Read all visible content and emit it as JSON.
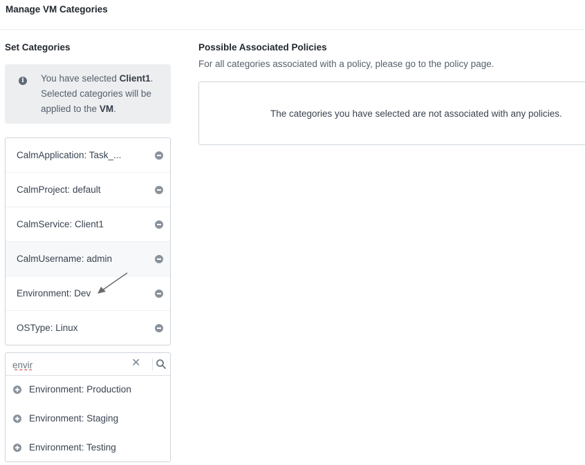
{
  "dialog": {
    "title": "Manage VM Categories"
  },
  "set_categories": {
    "heading": "Set Categories",
    "info": {
      "icon": "info-icon",
      "prefix": "You have selected ",
      "selected": "Client1",
      "middle": ". Selected categories will be applied to the ",
      "target": "VM",
      "suffix": "."
    },
    "items": [
      {
        "label": "CalmApplication: Task_..."
      },
      {
        "label": "CalmProject: default"
      },
      {
        "label": "CalmService: Client1"
      },
      {
        "label": "CalmUsername: admin"
      },
      {
        "label": "Environment: Dev"
      },
      {
        "label": "OSType: Linux"
      }
    ],
    "search": {
      "value": "envir",
      "clear_icon": "close-icon",
      "search_icon": "search-icon"
    },
    "suggestions": [
      {
        "label": "Environment: Production"
      },
      {
        "label": "Environment: Staging"
      },
      {
        "label": "Environment: Testing"
      }
    ]
  },
  "policies": {
    "heading": "Possible Associated Policies",
    "subtext": "For all categories associated with a policy, please go to the policy page.",
    "empty_message": "The categories you have selected are not associated with any policies."
  }
}
